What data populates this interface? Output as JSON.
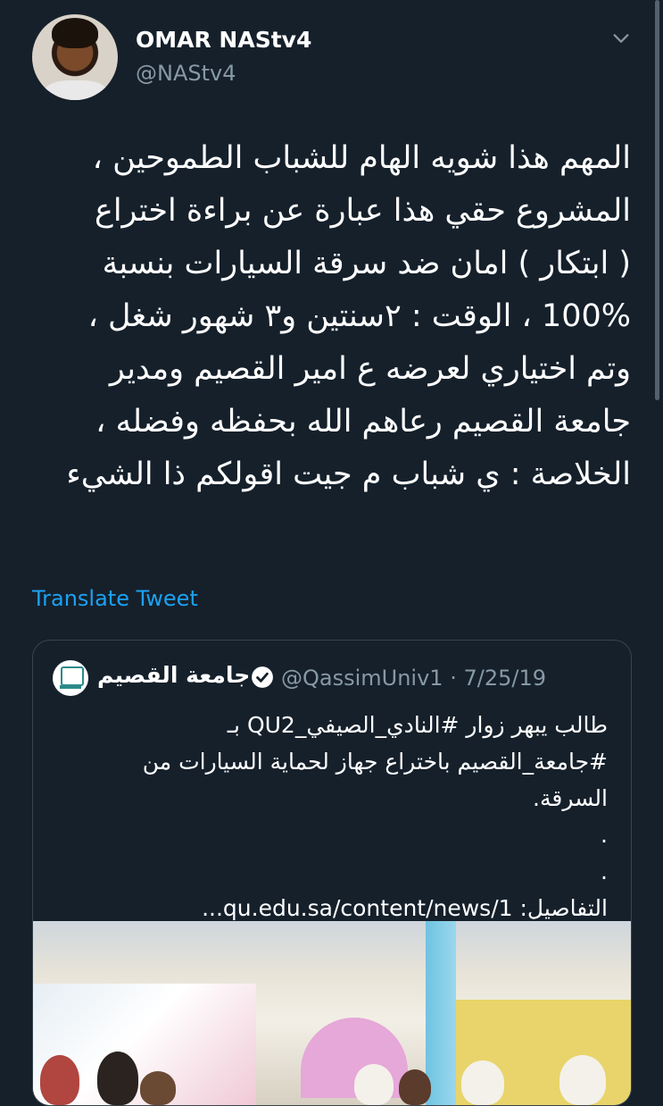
{
  "author": {
    "display_name": "OMAR NAStv4",
    "handle": "@NAStv4"
  },
  "icons": {
    "menu": "chevron-down-icon",
    "verified": "verified-badge-icon"
  },
  "tweet": {
    "lines": [
      "المهم هذا شويه الهام للشباب الطموحين ،",
      "المشروع حقي هذا عبارة عن براءة اختراع",
      "( ابتكار ) امان ضد سرقة السيارات بنسبة",
      "100% ، الوقت : ٢سنتين و٣ شهور شغل ،",
      "وتم اختياري لعرضه ع امير القصيم ومدير",
      "جامعة القصيم رعاهم الله بحفظه وفضله ،",
      "الخلاصة : ي شباب م جيت اقولكم ذا الشيء"
    ],
    "translate_label": "Translate Tweet"
  },
  "quoted": {
    "display_name": "جامعة القصيم",
    "meta": "@QassimUniv1 · 7/25/19",
    "lines": [
      "طالب يبهر زوار #النادي_الصيفي_QU2 بـ",
      "#جامعة_القصيم باختراع جهاز لحماية السيارات من",
      "السرقة.",
      ".",
      ".",
      "التفاصيل: qu.edu.sa/content/news/1..."
    ]
  },
  "colors": {
    "background": "#15202b",
    "text": "#ffffff",
    "secondary_text": "#8899a6",
    "link": "#1da1f2",
    "border": "#38444d"
  }
}
